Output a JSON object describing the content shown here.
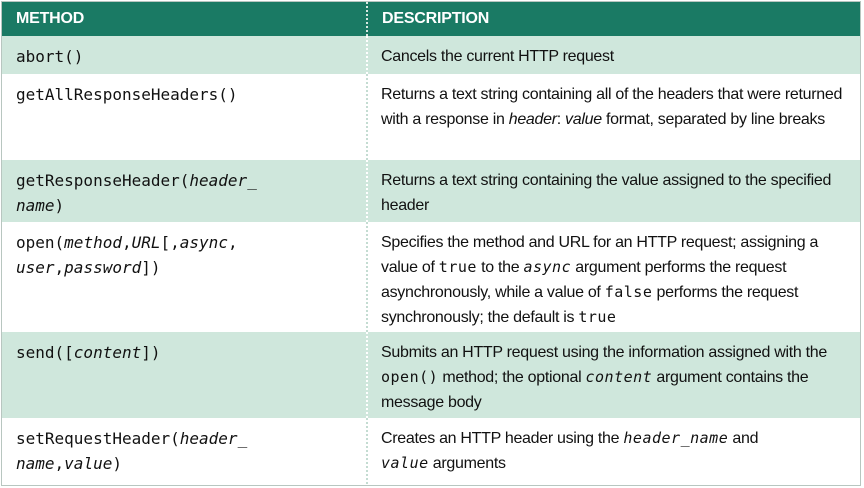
{
  "header": {
    "method": "METHOD",
    "description": "DESCRIPTION"
  },
  "rows": [
    {
      "method": [
        "abort()"
      ],
      "description": [
        "Cancels the current HTTP request"
      ]
    },
    {
      "method": [
        "getAllResponseHeaders()"
      ],
      "description": [
        "Returns a text string containing all of the headers that were returned with a response in ",
        "header",
        ": ",
        "value",
        " format, separated by line breaks"
      ]
    },
    {
      "method": [
        "getResponseHeader(",
        "header_",
        "name",
        ")"
      ],
      "description": [
        "Returns a text string containing the value assigned to the specified header"
      ]
    },
    {
      "method": [
        "open(",
        "method",
        ",",
        "URL",
        "[,",
        "async",
        ",",
        "user",
        ",",
        "password",
        "])"
      ],
      "description": [
        "Specifies the method and URL for an HTTP request; assigning a value of ",
        "true",
        " to the ",
        "async",
        " argument performs the request asynchronously, while a value of ",
        "false",
        " performs the request synchronously; the default is ",
        "true"
      ]
    },
    {
      "method": [
        "send([",
        "content",
        "])"
      ],
      "description": [
        "Submits an HTTP request using the information assigned with the ",
        "open()",
        " method; the optional ",
        "content",
        " argument contains the message body"
      ]
    },
    {
      "method": [
        "setRequestHeader(",
        "header_",
        "name",
        ",",
        "value",
        ")"
      ],
      "description": [
        "Creates an HTTP header using the ",
        "header_name",
        " and ",
        "value",
        " arguments"
      ]
    }
  ]
}
